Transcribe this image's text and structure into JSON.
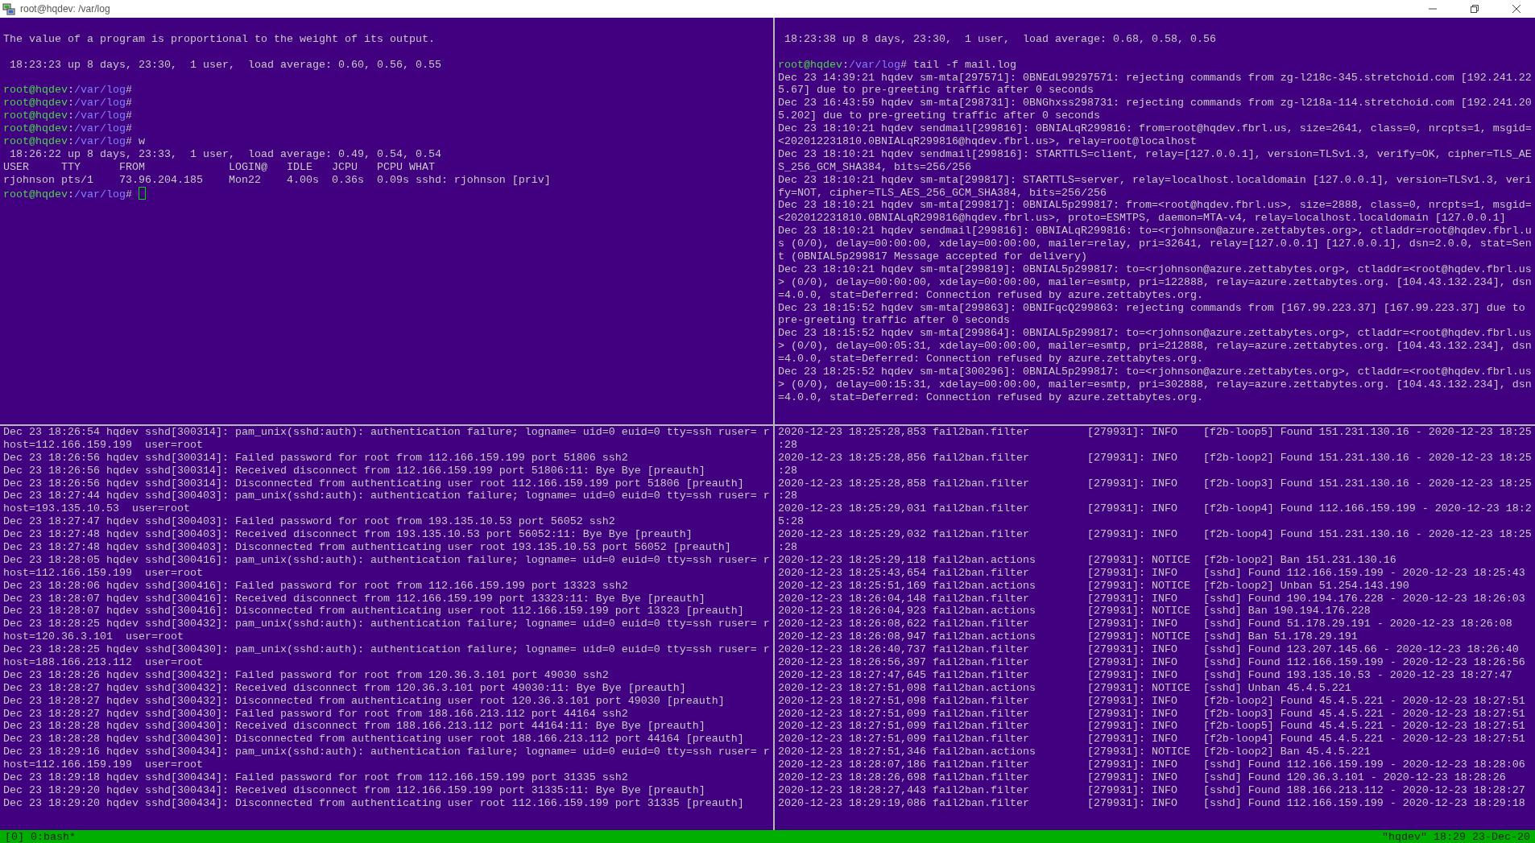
{
  "window": {
    "title": "root@hqdev: /var/log"
  },
  "panes": [
    {
      "lines": [
        {
          "kind": "blank"
        },
        {
          "kind": "text",
          "text": "The value of a program is proportional to the weight of its output."
        },
        {
          "kind": "blank"
        },
        {
          "kind": "text",
          "text": " 18:23:23 up 8 days, 23:30,  1 user,  load average: 0.60, 0.56, 0.55"
        },
        {
          "kind": "blank"
        },
        {
          "kind": "prompt",
          "user": "root@hqdev",
          "separator": ":",
          "path": "/var/log",
          "symbol": "#",
          "cursor": false
        },
        {
          "kind": "prompt",
          "user": "root@hqdev",
          "separator": ":",
          "path": "/var/log",
          "symbol": "#",
          "cursor": false
        },
        {
          "kind": "prompt",
          "user": "root@hqdev",
          "separator": ":",
          "path": "/var/log",
          "symbol": "#",
          "cursor": false
        },
        {
          "kind": "prompt",
          "user": "root@hqdev",
          "separator": ":",
          "path": "/var/log",
          "symbol": "#",
          "cursor": false
        },
        {
          "kind": "prompt",
          "user": "root@hqdev",
          "separator": ":",
          "path": "/var/log",
          "symbol": "#",
          "command": "w",
          "cursor": false
        },
        {
          "kind": "text",
          "text": " 18:26:22 up 8 days, 23:33,  1 user,  load average: 0.49, 0.54, 0.54"
        },
        {
          "kind": "text",
          "text": "USER     TTY      FROM             LOGIN@   IDLE   JCPU   PCPU WHAT"
        },
        {
          "kind": "text",
          "text": "rjohnson pts/1    73.96.204.185    Mon22    4.00s  0.36s  0.09s sshd: rjohnson [priv]"
        },
        {
          "kind": "prompt",
          "user": "root@hqdev",
          "separator": ":",
          "path": "/var/log",
          "symbol": "#",
          "cursor": true
        }
      ]
    },
    {
      "lines": [
        {
          "kind": "blank"
        },
        {
          "kind": "text",
          "text": " 18:23:38 up 8 days, 23:30,  1 user,  load average: 0.68, 0.58, 0.56"
        },
        {
          "kind": "blank"
        },
        {
          "kind": "prompt",
          "user": "root@hqdev",
          "separator": ":",
          "path": "/var/log",
          "symbol": "#",
          "command": "tail -f mail.log",
          "cursor": false
        },
        {
          "kind": "text",
          "text": "Dec 23 14:39:21 hqdev sm-mta[297571]: 0BNEdL99297571: rejecting commands from zg-l218c-345.stretchoid.com [192.241.22"
        },
        {
          "kind": "text",
          "text": "5.67] due to pre-greeting traffic after 0 seconds"
        },
        {
          "kind": "text",
          "text": "Dec 23 16:43:59 hqdev sm-mta[298731]: 0BNGhxss298731: rejecting commands from zg-l218a-114.stretchoid.com [192.241.20"
        },
        {
          "kind": "text",
          "text": "5.202] due to pre-greeting traffic after 0 seconds"
        },
        {
          "kind": "text",
          "text": "Dec 23 18:10:21 hqdev sendmail[299816]: 0BNIALqR299816: from=root@hqdev.fbrl.us, size=2641, class=0, nrcpts=1, msgid="
        },
        {
          "kind": "text",
          "text": "<202012231810.0BNIALqR299816@hqdev.fbrl.us>, relay=root@localhost"
        },
        {
          "kind": "text",
          "text": "Dec 23 18:10:21 hqdev sendmail[299816]: STARTTLS=client, relay=[127.0.0.1], version=TLSv1.3, verify=OK, cipher=TLS_AE"
        },
        {
          "kind": "text",
          "text": "S_256_GCM_SHA384, bits=256/256"
        },
        {
          "kind": "text",
          "text": "Dec 23 18:10:21 hqdev sm-mta[299817]: STARTTLS=server, relay=localhost.localdomain [127.0.0.1], version=TLSv1.3, veri"
        },
        {
          "kind": "text",
          "text": "fy=NOT, cipher=TLS_AES_256_GCM_SHA384, bits=256/256"
        },
        {
          "kind": "text",
          "text": "Dec 23 18:10:21 hqdev sm-mta[299817]: 0BNIAL5p299817: from=<root@hqdev.fbrl.us>, size=2888, class=0, nrcpts=1, msgid="
        },
        {
          "kind": "text",
          "text": "<202012231810.0BNIALqR299816@hqdev.fbrl.us>, proto=ESMTPS, daemon=MTA-v4, relay=localhost.localdomain [127.0.0.1]"
        },
        {
          "kind": "text",
          "text": "Dec 23 18:10:21 hqdev sendmail[299816]: 0BNIALqR299816: to=<rjohnson@azure.zettabytes.org>, ctladdr=root@hqdev.fbrl.u"
        },
        {
          "kind": "text",
          "text": "s (0/0), delay=00:00:00, xdelay=00:00:00, mailer=relay, pri=32641, relay=[127.0.0.1] [127.0.0.1], dsn=2.0.0, stat=Sen"
        },
        {
          "kind": "text",
          "text": "t (0BNIAL5p299817 Message accepted for delivery)"
        },
        {
          "kind": "text",
          "text": "Dec 23 18:10:21 hqdev sm-mta[299819]: 0BNIAL5p299817: to=<rjohnson@azure.zettabytes.org>, ctladdr=<root@hqdev.fbrl.us"
        },
        {
          "kind": "text",
          "text": "> (0/0), delay=00:00:00, xdelay=00:00:00, mailer=esmtp, pri=122888, relay=azure.zettabytes.org. [104.43.132.234], dsn"
        },
        {
          "kind": "text",
          "text": "=4.0.0, stat=Deferred: Connection refused by azure.zettabytes.org."
        },
        {
          "kind": "text",
          "text": "Dec 23 18:15:52 hqdev sm-mta[299863]: 0BNIFqcQ299863: rejecting commands from [167.99.223.37] [167.99.223.37] due to"
        },
        {
          "kind": "text",
          "text": "pre-greeting traffic after 0 seconds"
        },
        {
          "kind": "text",
          "text": "Dec 23 18:15:52 hqdev sm-mta[299864]: 0BNIAL5p299817: to=<rjohnson@azure.zettabytes.org>, ctladdr=<root@hqdev.fbrl.us"
        },
        {
          "kind": "text",
          "text": "> (0/0), delay=00:05:31, xdelay=00:00:00, mailer=esmtp, pri=212888, relay=azure.zettabytes.org. [104.43.132.234], dsn"
        },
        {
          "kind": "text",
          "text": "=4.0.0, stat=Deferred: Connection refused by azure.zettabytes.org."
        },
        {
          "kind": "text",
          "text": "Dec 23 18:25:52 hqdev sm-mta[300296]: 0BNIAL5p299817: to=<rjohnson@azure.zettabytes.org>, ctladdr=<root@hqdev.fbrl.us"
        },
        {
          "kind": "text",
          "text": "> (0/0), delay=00:15:31, xdelay=00:00:00, mailer=esmtp, pri=302888, relay=azure.zettabytes.org. [104.43.132.234], dsn"
        },
        {
          "kind": "text",
          "text": "=4.0.0, stat=Deferred: Connection refused by azure.zettabytes.org."
        }
      ]
    },
    {
      "lines": [
        {
          "kind": "text",
          "text": "Dec 23 18:26:54 hqdev sshd[300314]: pam_unix(sshd:auth): authentication failure; logname= uid=0 euid=0 tty=ssh ruser= r"
        },
        {
          "kind": "text",
          "text": "host=112.166.159.199  user=root"
        },
        {
          "kind": "text",
          "text": "Dec 23 18:26:56 hqdev sshd[300314]: Failed password for root from 112.166.159.199 port 51806 ssh2"
        },
        {
          "kind": "text",
          "text": "Dec 23 18:26:56 hqdev sshd[300314]: Received disconnect from 112.166.159.199 port 51806:11: Bye Bye [preauth]"
        },
        {
          "kind": "text",
          "text": "Dec 23 18:26:56 hqdev sshd[300314]: Disconnected from authenticating user root 112.166.159.199 port 51806 [preauth]"
        },
        {
          "kind": "text",
          "text": "Dec 23 18:27:44 hqdev sshd[300403]: pam_unix(sshd:auth): authentication failure; logname= uid=0 euid=0 tty=ssh ruser= r"
        },
        {
          "kind": "text",
          "text": "host=193.135.10.53  user=root"
        },
        {
          "kind": "text",
          "text": "Dec 23 18:27:47 hqdev sshd[300403]: Failed password for root from 193.135.10.53 port 56052 ssh2"
        },
        {
          "kind": "text",
          "text": "Dec 23 18:27:48 hqdev sshd[300403]: Received disconnect from 193.135.10.53 port 56052:11: Bye Bye [preauth]"
        },
        {
          "kind": "text",
          "text": "Dec 23 18:27:48 hqdev sshd[300403]: Disconnected from authenticating user root 193.135.10.53 port 56052 [preauth]"
        },
        {
          "kind": "text",
          "text": "Dec 23 18:28:05 hqdev sshd[300416]: pam_unix(sshd:auth): authentication failure; logname= uid=0 euid=0 tty=ssh ruser= r"
        },
        {
          "kind": "text",
          "text": "host=112.166.159.199  user=root"
        },
        {
          "kind": "text",
          "text": "Dec 23 18:28:06 hqdev sshd[300416]: Failed password for root from 112.166.159.199 port 13323 ssh2"
        },
        {
          "kind": "text",
          "text": "Dec 23 18:28:07 hqdev sshd[300416]: Received disconnect from 112.166.159.199 port 13323:11: Bye Bye [preauth]"
        },
        {
          "kind": "text",
          "text": "Dec 23 18:28:07 hqdev sshd[300416]: Disconnected from authenticating user root 112.166.159.199 port 13323 [preauth]"
        },
        {
          "kind": "text",
          "text": "Dec 23 18:28:25 hqdev sshd[300432]: pam_unix(sshd:auth): authentication failure; logname= uid=0 euid=0 tty=ssh ruser= r"
        },
        {
          "kind": "text",
          "text": "host=120.36.3.101  user=root"
        },
        {
          "kind": "text",
          "text": "Dec 23 18:28:25 hqdev sshd[300430]: pam_unix(sshd:auth): authentication failure; logname= uid=0 euid=0 tty=ssh ruser= r"
        },
        {
          "kind": "text",
          "text": "host=188.166.213.112  user=root"
        },
        {
          "kind": "text",
          "text": "Dec 23 18:28:26 hqdev sshd[300432]: Failed password for root from 120.36.3.101 port 49030 ssh2"
        },
        {
          "kind": "text",
          "text": "Dec 23 18:28:27 hqdev sshd[300432]: Received disconnect from 120.36.3.101 port 49030:11: Bye Bye [preauth]"
        },
        {
          "kind": "text",
          "text": "Dec 23 18:28:27 hqdev sshd[300432]: Disconnected from authenticating user root 120.36.3.101 port 49030 [preauth]"
        },
        {
          "kind": "text",
          "text": "Dec 23 18:28:27 hqdev sshd[300430]: Failed password for root from 188.166.213.112 port 44164 ssh2"
        },
        {
          "kind": "text",
          "text": "Dec 23 18:28:28 hqdev sshd[300430]: Received disconnect from 188.166.213.112 port 44164:11: Bye Bye [preauth]"
        },
        {
          "kind": "text",
          "text": "Dec 23 18:28:28 hqdev sshd[300430]: Disconnected from authenticating user root 188.166.213.112 port 44164 [preauth]"
        },
        {
          "kind": "text",
          "text": "Dec 23 18:29:16 hqdev sshd[300434]: pam_unix(sshd:auth): authentication failure; logname= uid=0 euid=0 tty=ssh ruser= r"
        },
        {
          "kind": "text",
          "text": "host=112.166.159.199  user=root"
        },
        {
          "kind": "text",
          "text": "Dec 23 18:29:18 hqdev sshd[300434]: Failed password for root from 112.166.159.199 port 31335 ssh2"
        },
        {
          "kind": "text",
          "text": "Dec 23 18:29:20 hqdev sshd[300434]: Received disconnect from 112.166.159.199 port 31335:11: Bye Bye [preauth]"
        },
        {
          "kind": "text",
          "text": "Dec 23 18:29:20 hqdev sshd[300434]: Disconnected from authenticating user root 112.166.159.199 port 31335 [preauth]"
        }
      ]
    },
    {
      "lines": [
        {
          "kind": "text",
          "text": "2020-12-23 18:25:28,853 fail2ban.filter         [279931]: INFO    [f2b-loop5] Found 151.231.130.16 - 2020-12-23 18:25"
        },
        {
          "kind": "text",
          "text": ":28"
        },
        {
          "kind": "text",
          "text": "2020-12-23 18:25:28,856 fail2ban.filter         [279931]: INFO    [f2b-loop2] Found 151.231.130.16 - 2020-12-23 18:25"
        },
        {
          "kind": "text",
          "text": ":28"
        },
        {
          "kind": "text",
          "text": "2020-12-23 18:25:28,858 fail2ban.filter         [279931]: INFO    [f2b-loop3] Found 151.231.130.16 - 2020-12-23 18:25"
        },
        {
          "kind": "text",
          "text": ":28"
        },
        {
          "kind": "text",
          "text": "2020-12-23 18:25:29,031 fail2ban.filter         [279931]: INFO    [f2b-loop4] Found 112.166.159.199 - 2020-12-23 18:2"
        },
        {
          "kind": "text",
          "text": "5:28"
        },
        {
          "kind": "text",
          "text": "2020-12-23 18:25:29,032 fail2ban.filter         [279931]: INFO    [f2b-loop4] Found 151.231.130.16 - 2020-12-23 18:25"
        },
        {
          "kind": "text",
          "text": ":28"
        },
        {
          "kind": "text",
          "text": "2020-12-23 18:25:29,118 fail2ban.actions        [279931]: NOTICE  [f2b-loop2] Ban 151.231.130.16"
        },
        {
          "kind": "text",
          "text": "2020-12-23 18:25:43,654 fail2ban.filter         [279931]: INFO    [sshd] Found 112.166.159.199 - 2020-12-23 18:25:43"
        },
        {
          "kind": "text",
          "text": "2020-12-23 18:25:51,169 fail2ban.actions        [279931]: NOTICE  [f2b-loop2] Unban 51.254.143.190"
        },
        {
          "kind": "text",
          "text": "2020-12-23 18:26:04,148 fail2ban.filter         [279931]: INFO    [sshd] Found 190.194.176.228 - 2020-12-23 18:26:03"
        },
        {
          "kind": "text",
          "text": "2020-12-23 18:26:04,923 fail2ban.actions        [279931]: NOTICE  [sshd] Ban 190.194.176.228"
        },
        {
          "kind": "text",
          "text": "2020-12-23 18:26:08,622 fail2ban.filter         [279931]: INFO    [sshd] Found 51.178.29.191 - 2020-12-23 18:26:08"
        },
        {
          "kind": "text",
          "text": "2020-12-23 18:26:08,947 fail2ban.actions        [279931]: NOTICE  [sshd] Ban 51.178.29.191"
        },
        {
          "kind": "text",
          "text": "2020-12-23 18:26:40,737 fail2ban.filter         [279931]: INFO    [sshd] Found 123.207.145.66 - 2020-12-23 18:26:40"
        },
        {
          "kind": "text",
          "text": "2020-12-23 18:26:56,397 fail2ban.filter         [279931]: INFO    [sshd] Found 112.166.159.199 - 2020-12-23 18:26:56"
        },
        {
          "kind": "text",
          "text": "2020-12-23 18:27:47,645 fail2ban.filter         [279931]: INFO    [sshd] Found 193.135.10.53 - 2020-12-23 18:27:47"
        },
        {
          "kind": "text",
          "text": "2020-12-23 18:27:51,098 fail2ban.actions        [279931]: NOTICE  [sshd] Unban 45.4.5.221"
        },
        {
          "kind": "text",
          "text": "2020-12-23 18:27:51,098 fail2ban.filter         [279931]: INFO    [f2b-loop2] Found 45.4.5.221 - 2020-12-23 18:27:51"
        },
        {
          "kind": "text",
          "text": "2020-12-23 18:27:51,099 fail2ban.filter         [279931]: INFO    [f2b-loop3] Found 45.4.5.221 - 2020-12-23 18:27:51"
        },
        {
          "kind": "text",
          "text": "2020-12-23 18:27:51,099 fail2ban.filter         [279931]: INFO    [f2b-loop5] Found 45.4.5.221 - 2020-12-23 18:27:51"
        },
        {
          "kind": "text",
          "text": "2020-12-23 18:27:51,099 fail2ban.filter         [279931]: INFO    [f2b-loop4] Found 45.4.5.221 - 2020-12-23 18:27:51"
        },
        {
          "kind": "text",
          "text": "2020-12-23 18:27:51,346 fail2ban.actions        [279931]: NOTICE  [f2b-loop2] Ban 45.4.5.221"
        },
        {
          "kind": "text",
          "text": "2020-12-23 18:28:07,186 fail2ban.filter         [279931]: INFO    [sshd] Found 112.166.159.199 - 2020-12-23 18:28:06"
        },
        {
          "kind": "text",
          "text": "2020-12-23 18:28:26,698 fail2ban.filter         [279931]: INFO    [sshd] Found 120.36.3.101 - 2020-12-23 18:28:26"
        },
        {
          "kind": "text",
          "text": "2020-12-23 18:28:27,443 fail2ban.filter         [279931]: INFO    [sshd] Found 188.166.213.112 - 2020-12-23 18:28:27"
        },
        {
          "kind": "text",
          "text": "2020-12-23 18:29:19,086 fail2ban.filter         [279931]: INFO    [sshd] Found 112.166.159.199 - 2020-12-23 18:29:18"
        }
      ]
    }
  ],
  "status_bar": {
    "left": "[0] 0:bash*",
    "right": "\"hqdev\" 18:29 23-Dec-20"
  }
}
